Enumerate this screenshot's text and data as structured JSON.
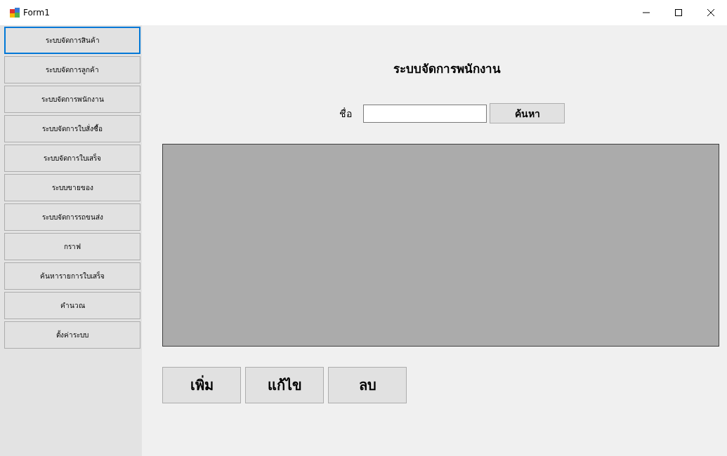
{
  "window": {
    "title": "Form1"
  },
  "sidebar": {
    "items": [
      {
        "label": "ระบบจัดการสินค้า",
        "focused": true
      },
      {
        "label": "ระบบจัดการลูกค้า",
        "focused": false
      },
      {
        "label": "ระบบจัดการพนักงาน",
        "focused": false
      },
      {
        "label": "ระบบจัดการใบสั่งซื้อ",
        "focused": false
      },
      {
        "label": "ระบบจัดการใบเสร็จ",
        "focused": false
      },
      {
        "label": "ระบบขายของ",
        "focused": false
      },
      {
        "label": "ระบบจัดการรถขนส่ง",
        "focused": false
      },
      {
        "label": "กราฟ",
        "focused": false
      },
      {
        "label": "ค้นหารายการใบเสร็จ",
        "focused": false
      },
      {
        "label": "คำนวณ",
        "focused": false
      },
      {
        "label": "ตั้งค่าระบบ",
        "focused": false
      }
    ]
  },
  "heading": "ระบบจัดการพนักงาน",
  "search": {
    "label": "ชื่อ",
    "button": "ค้นหา"
  },
  "actions": [
    "เพิ่ม",
    "แก้ไข",
    "ลบ"
  ]
}
